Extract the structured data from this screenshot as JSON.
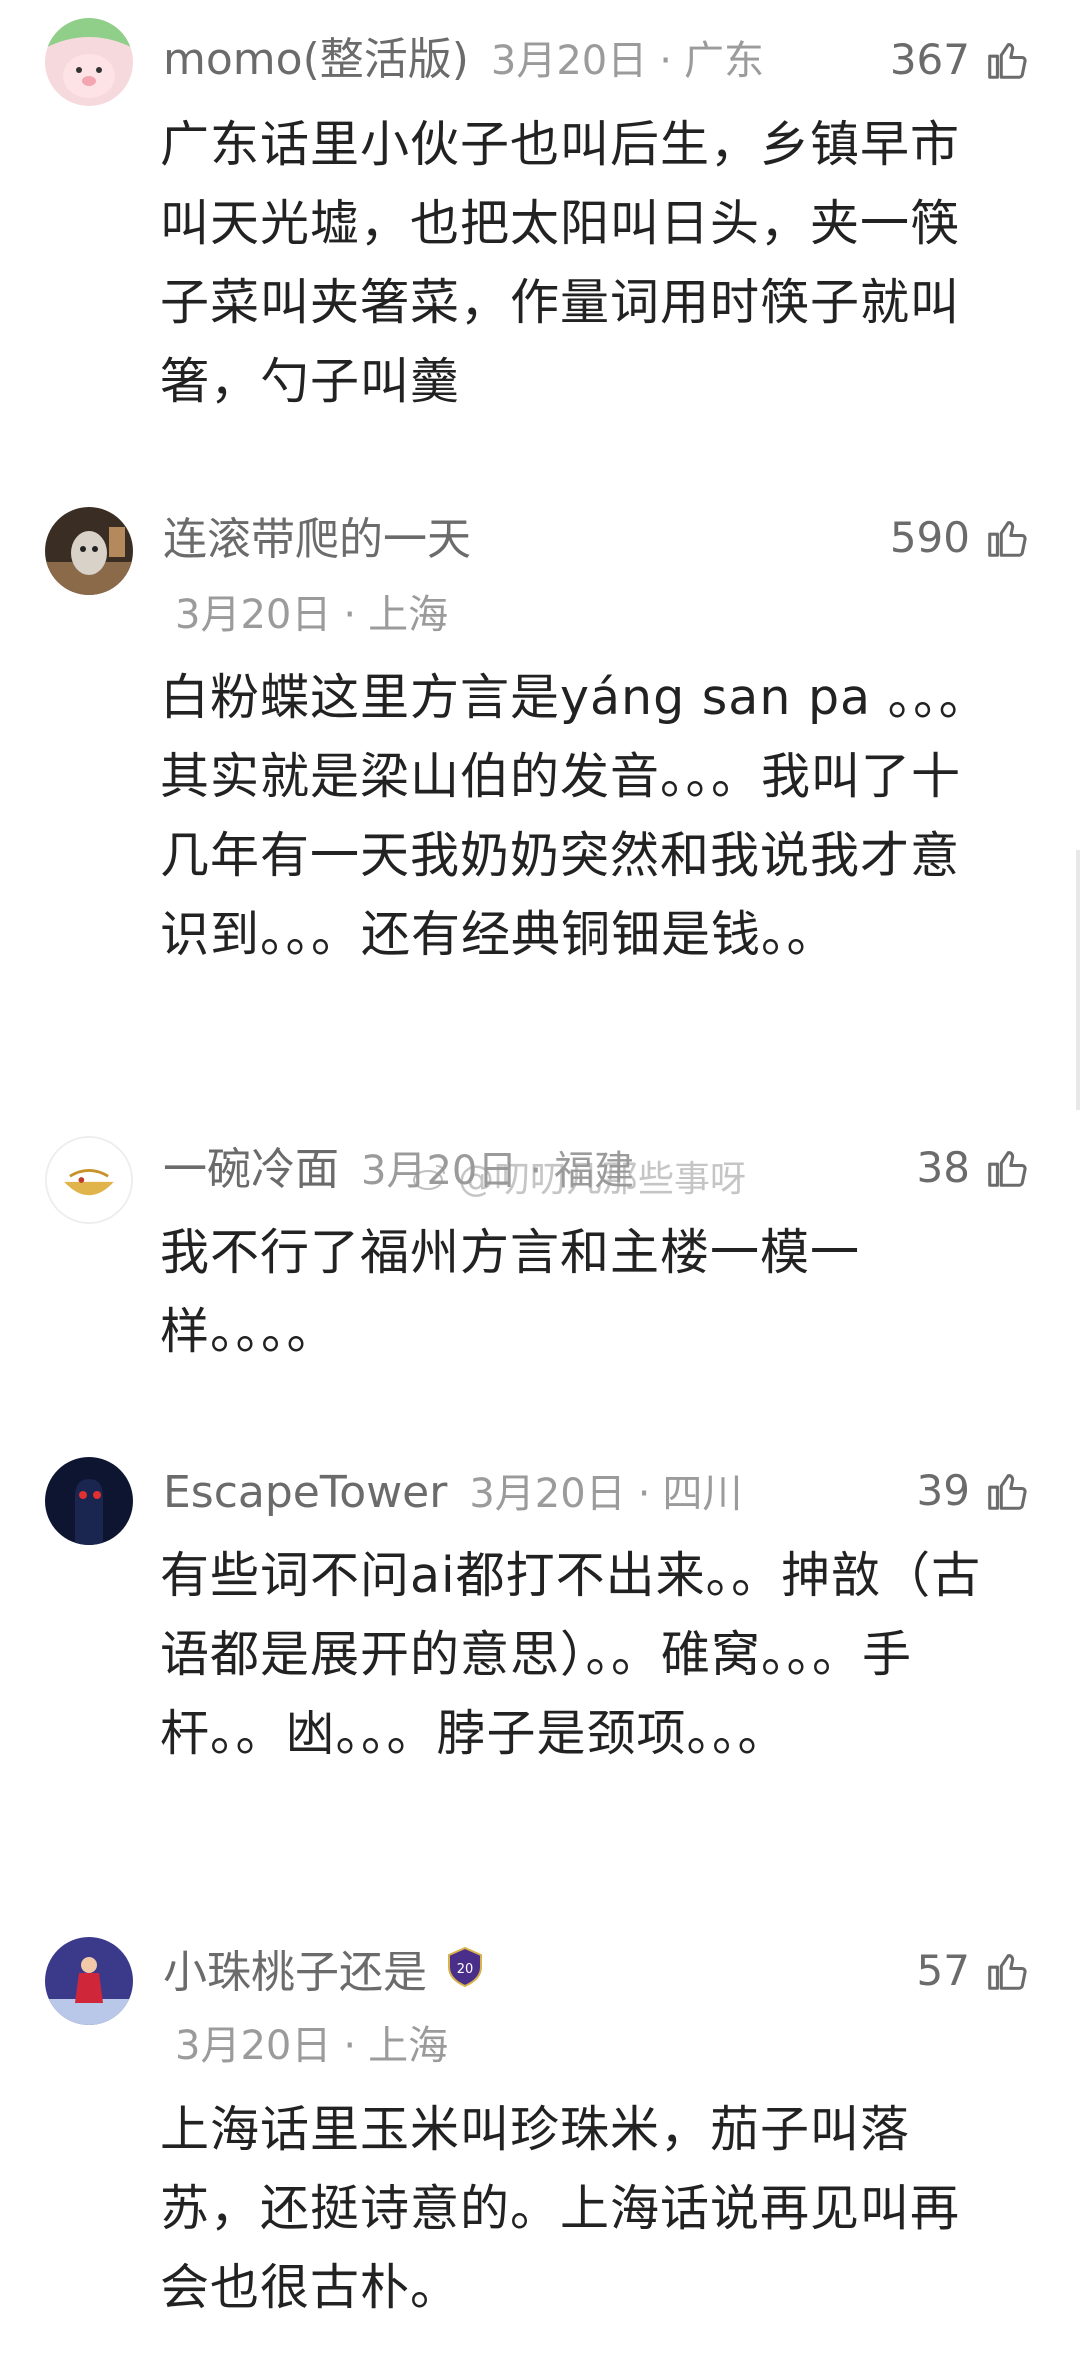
{
  "comments": [
    {
      "username": "momo(整活版)",
      "date": "3月20日",
      "location": "广东",
      "likes": "367",
      "text": "广东话里小伙子也叫后生，乡镇早市叫天光墟，也把太阳叫日头，夹一筷子菜叫夹箸菜，作量词用时筷子就叫箸，勺子叫羹",
      "avatar_color": "#a8d8a8"
    },
    {
      "username": "连滚带爬的一天",
      "date": "3月20日",
      "location": "上海",
      "likes": "590",
      "text": "白粉蝶这里方言是yáng san pa 。。。其实就是梁山伯的发音。。。我叫了十几年有一天我奶奶突然和我说我才意识到。。。还有经典铜钿是钱。。",
      "avatar_color": "#5a4a3a"
    },
    {
      "username": "一碗冷面",
      "date": "3月20日",
      "location": "福建",
      "likes": "38",
      "text": "我不行了福州方言和主楼一模一样。。。。",
      "avatar_color": "#f2eee8"
    },
    {
      "username": "EscapeTower",
      "date": "3月20日",
      "location": "四川",
      "likes": "39",
      "text": "有些词不问ai都打不出来。。抻敨（古语都是展开的意思）。。碓窝。。。手杆。。凼。。。脖子是颈项。。。",
      "avatar_color": "#0e1530"
    },
    {
      "username": "小珠桃子还是",
      "badge": "20",
      "date": "3月20日",
      "location": "上海",
      "likes": "57",
      "text": "上海话里玉米叫珍珠米，茄子叫落苏，还挺诗意的。上海话说再见叫再会也很古朴。",
      "avatar_color": "#3b3a8a"
    }
  ],
  "watermark": "@叨叨几那些事呀",
  "colors": {
    "username": "#6b6b6b",
    "meta": "#9b9b9b",
    "text": "#222222",
    "background": "#ffffff"
  },
  "icons": {
    "like": "thumbs-up-icon",
    "separator": "·"
  }
}
